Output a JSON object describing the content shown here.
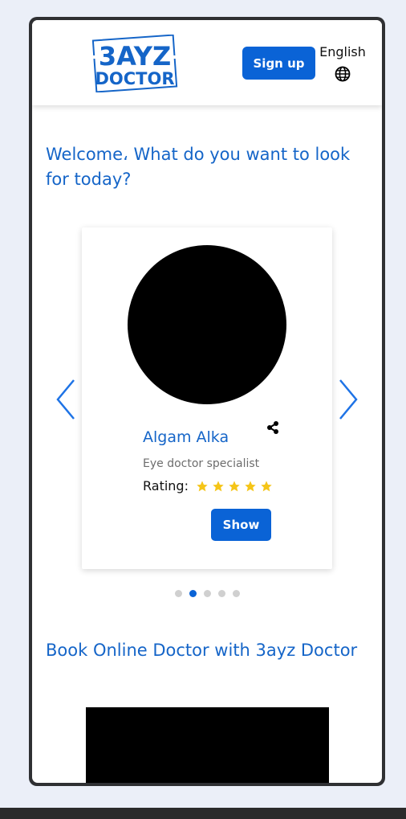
{
  "header": {
    "logo_line1": "3AYZ",
    "logo_line2": "DOCTOR",
    "signup_label": "Sign up",
    "language_label": "English",
    "brand_color": "#0a63d6"
  },
  "welcome_text": "Welcome، What do you want to look for today?",
  "carousel": {
    "doctor": {
      "name": "Algam Alka",
      "specialty": "Eye doctor specialist",
      "rating_label": "Rating:",
      "rating_stars": 5,
      "show_label": "Show"
    },
    "dots_count": 5,
    "active_dot": 1,
    "star_color": "#f5c518"
  },
  "section": {
    "title": "Book Online Doctor with 3ayz Doctor"
  },
  "icons": [
    "globe-icon",
    "share-icon",
    "star-icon",
    "chevron-left-icon",
    "chevron-right-icon"
  ]
}
